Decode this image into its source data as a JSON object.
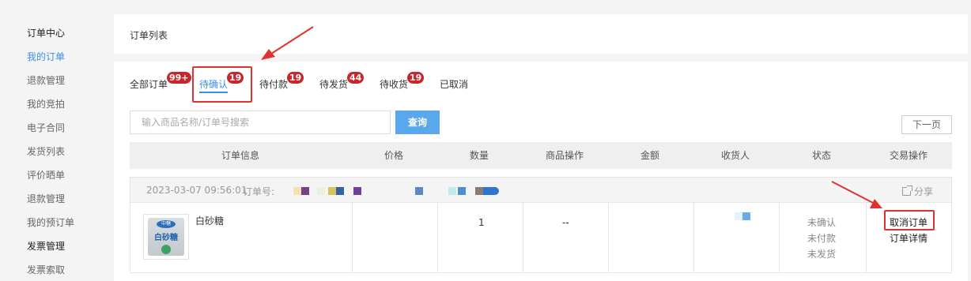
{
  "sidebar": {
    "items": [
      {
        "label": "订单中心",
        "type": "section"
      },
      {
        "label": "我的订单",
        "type": "active"
      },
      {
        "label": "退款管理",
        "type": "item"
      },
      {
        "label": "我的竞拍",
        "type": "item"
      },
      {
        "label": "电子合同",
        "type": "item"
      },
      {
        "label": "发货列表",
        "type": "item"
      },
      {
        "label": "评价晒单",
        "type": "item"
      },
      {
        "label": "退款管理",
        "type": "item"
      },
      {
        "label": "我的预订单",
        "type": "item"
      },
      {
        "label": "发票管理",
        "type": "section"
      },
      {
        "label": "发票索取",
        "type": "item"
      }
    ]
  },
  "header": {
    "title": "订单列表"
  },
  "tabs": [
    {
      "label": "全部订单",
      "badge": "99+"
    },
    {
      "label": "待确认",
      "badge": "19",
      "active": true
    },
    {
      "label": "待付款",
      "badge": "19"
    },
    {
      "label": "待发货",
      "badge": "44"
    },
    {
      "label": "待收货",
      "badge": "19"
    },
    {
      "label": "已取消",
      "badge": ""
    }
  ],
  "search": {
    "placeholder": "输入商品名称/订单号搜索",
    "button": "查询",
    "next_page": "下一页"
  },
  "table": {
    "columns": [
      "订单信息",
      "价格",
      "数量",
      "商品操作",
      "金额",
      "收货人",
      "状态",
      "交易操作"
    ]
  },
  "order": {
    "time": "2023-03-07 09:56:01",
    "order_no_label": "订单号:",
    "share": "分享",
    "product": {
      "name": "白砂糖",
      "bag_logo": "中糖",
      "bag_text": "白砂糖"
    },
    "price": "",
    "quantity": "1",
    "product_ops": "--",
    "amount": "",
    "status_lines": [
      "未确认",
      "未付款",
      "未发货"
    ],
    "actions": [
      "取消订单",
      "订单详情"
    ]
  },
  "colors": {
    "accent": "#3d8ee6",
    "badge": "#c9262c",
    "annotation": "#e0332f",
    "button": "#5ba7ec"
  }
}
